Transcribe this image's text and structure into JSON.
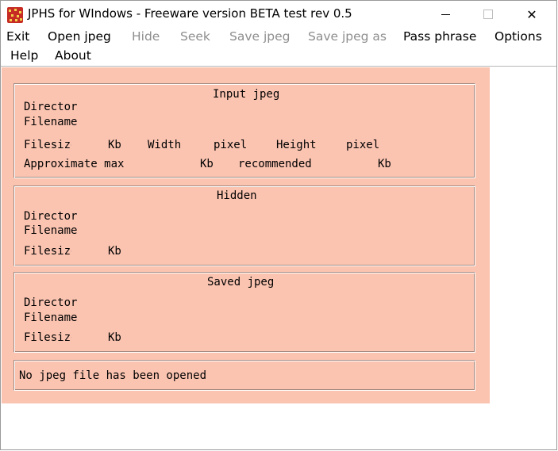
{
  "window": {
    "title": "JPHS for WIndows - Freeware version BETA test rev 0.5",
    "icon": "jphs-app-icon",
    "controls": {
      "minimize": "minimize-icon",
      "maximize": "maximize-icon",
      "close": "✕"
    }
  },
  "menu": {
    "exit": "Exit",
    "open_jpeg": "Open jpeg",
    "hide": "Hide",
    "seek": "Seek",
    "save_jpeg": "Save jpeg",
    "save_jpeg_as": "Save jpeg as",
    "pass_phrase": "Pass phrase",
    "options": "Options",
    "help": "Help",
    "about": "About"
  },
  "input_jpeg": {
    "title": "Input jpeg",
    "directory_label": "Directory",
    "filename_label": "Filename",
    "filesize_label": "Filesize",
    "kb_label": "Kb",
    "width_label": "Width",
    "pixel_label_1": "pixel",
    "height_label": "Height",
    "pixel_label_2": "pixel",
    "approx_max_label": "Approximate max",
    "approx_kb_label": "Kb",
    "recommended_label": "recommended",
    "recommended_kb_label": "Kb"
  },
  "hidden": {
    "title": "Hidden",
    "directory_label": "Directory",
    "filename_label": "Filename",
    "filesize_label": "Filesize",
    "kb_label": "Kb"
  },
  "saved_jpeg": {
    "title": "Saved jpeg",
    "directory_label": "Directory",
    "filename_label": "Filename",
    "filesize_label": "Filesize",
    "kb_label": "Kb"
  },
  "status": {
    "message": "No jpeg file has been opened"
  },
  "colors": {
    "client_background": "#fbc4b1",
    "disabled_menu_text": "#8e8e8e"
  }
}
